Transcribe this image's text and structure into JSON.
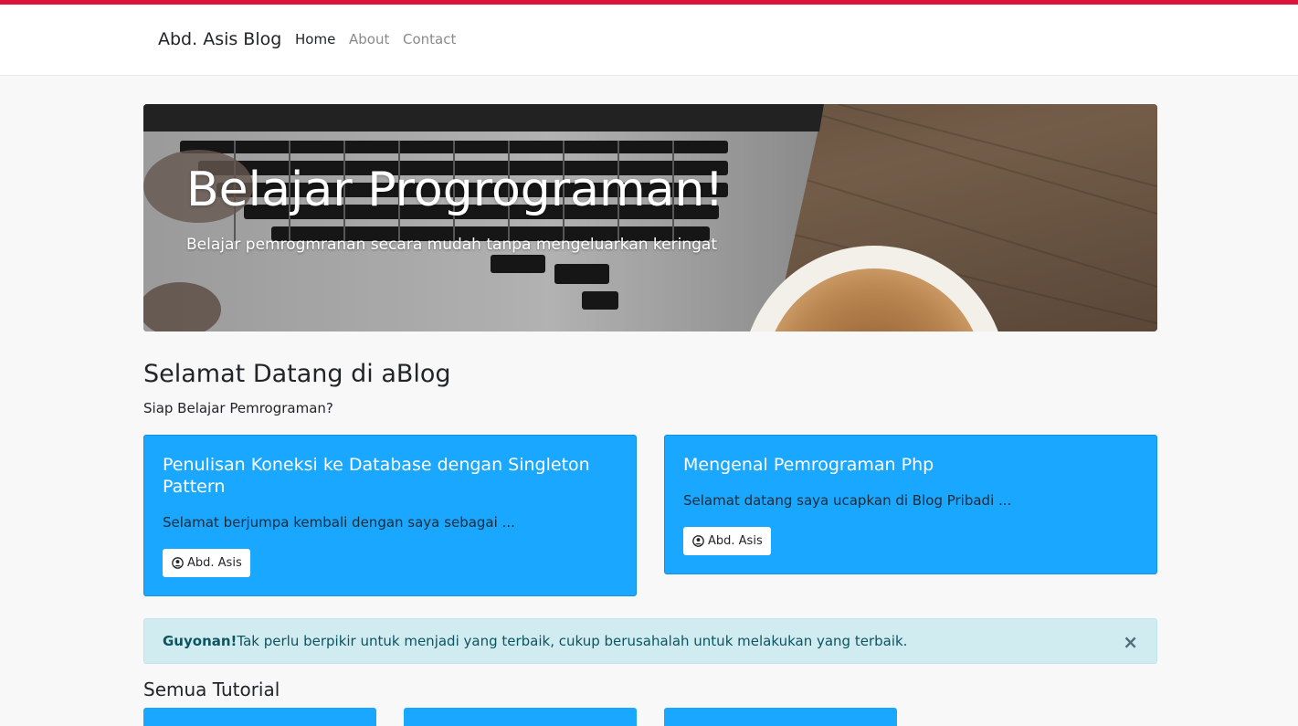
{
  "nav": {
    "brand": "Abd. Asis Blog",
    "links": [
      "Home",
      "About",
      "Contact"
    ],
    "active": "Home"
  },
  "hero": {
    "title": "Belajar Progrograman!",
    "subtitle": "Belajar pemrogmranan secara mudah tanpa mengeluarkan keringat"
  },
  "welcome": {
    "title": "Selamat Datang di aBlog",
    "subtitle": "Siap Belajar Pemrograman?"
  },
  "featured": [
    {
      "title": "Penulisan Koneksi ke Database dengan Singleton Pattern",
      "excerpt": "Selamat berjumpa kembali dengan saya sebagai ...",
      "author": "Abd. Asis"
    },
    {
      "title": "Mengenal Pemrograman Php",
      "excerpt": "Selamat datang saya ucapkan di Blog Pribadi ...",
      "author": "Abd. Asis"
    }
  ],
  "alert": {
    "strong": "Guyonan!",
    "text": "Tak perlu berpikir untuk menjadi yang terbaik, cukup berusahalah untuk melakukan yang terbaik.",
    "close": "×"
  },
  "tutorials": {
    "title": "Semua Tutorial"
  },
  "colors": {
    "accent_bar": "#dc143c",
    "card": "#1aa7ff",
    "alert_bg": "#d1ecf1"
  }
}
